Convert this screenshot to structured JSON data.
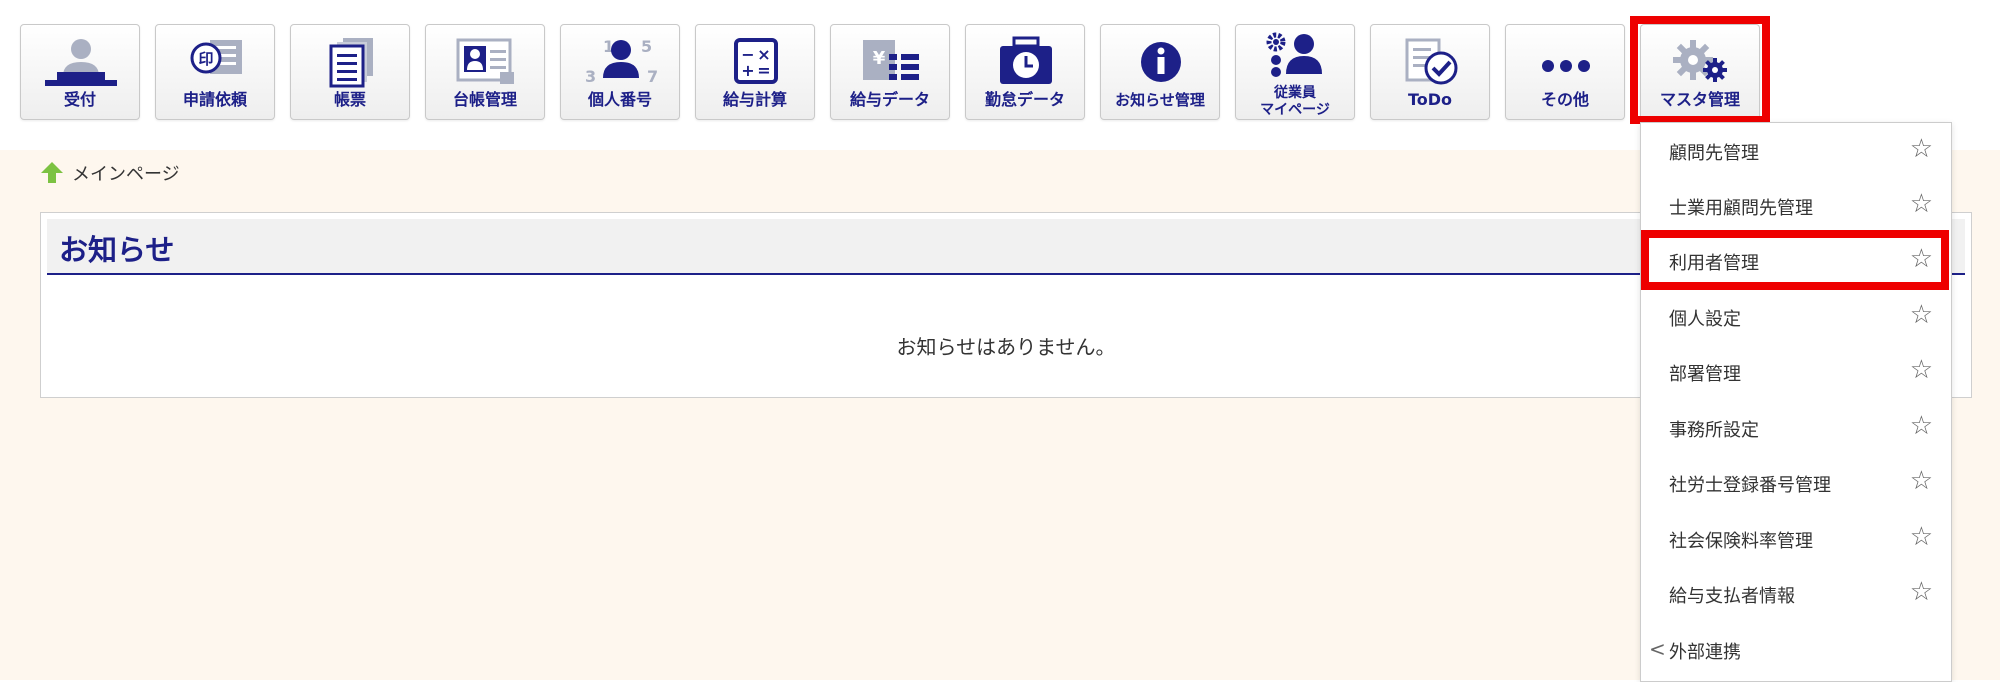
{
  "toolbar": {
    "buttons": [
      {
        "label": "受付",
        "icon": "reception-icon"
      },
      {
        "label": "申請依頼",
        "icon": "seal-document-icon"
      },
      {
        "label": "帳票",
        "icon": "forms-icon"
      },
      {
        "label": "台帳管理",
        "icon": "ledger-card-icon"
      },
      {
        "label": "個人番号",
        "icon": "personal-number-icon"
      },
      {
        "label": "給与計算",
        "icon": "calculator-icon"
      },
      {
        "label": "給与データ",
        "icon": "payroll-data-icon"
      },
      {
        "label": "勤怠データ",
        "icon": "attendance-clock-icon"
      },
      {
        "label": "お知らせ管理",
        "icon": "info-icon"
      },
      {
        "label": "従業員\nマイページ",
        "icon": "employee-mypage-icon"
      },
      {
        "label": "ToDo",
        "icon": "todo-check-icon"
      },
      {
        "label": "その他",
        "icon": "more-dots-icon"
      },
      {
        "label": "マスタ管理",
        "icon": "gear-icon"
      }
    ]
  },
  "breadcrumb": {
    "label": "メインページ",
    "icon": "home-arrow-icon"
  },
  "notice_panel": {
    "title": "お知らせ",
    "empty_message": "お知らせはありません。"
  },
  "master_menu": {
    "items": [
      {
        "label": "顧問先管理"
      },
      {
        "label": "士業用顧問先管理"
      },
      {
        "label": "利用者管理",
        "highlighted": true
      },
      {
        "label": "個人設定"
      },
      {
        "label": "部署管理"
      },
      {
        "label": "事務所設定"
      },
      {
        "label": "社労士登録番号管理"
      },
      {
        "label": "社会保険料率管理"
      },
      {
        "label": "給与支払者情報"
      }
    ],
    "submenu": {
      "label": "外部連携",
      "chevron": "<"
    },
    "star_glyph": "☆"
  },
  "colors": {
    "accent": "#1d2088",
    "highlight": "#ee0000",
    "background": "#fef7ee",
    "home_icon": "#7cc242"
  }
}
